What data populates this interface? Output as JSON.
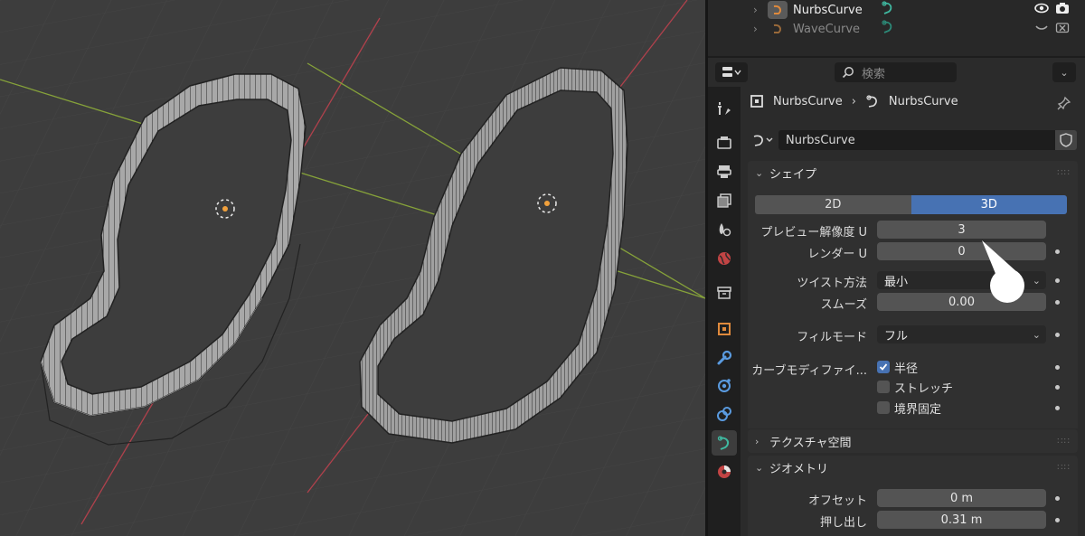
{
  "outliner": {
    "rows": [
      {
        "name": "NurbsCurve",
        "selected": true
      },
      {
        "name": "WaveCurve",
        "selected": false
      }
    ]
  },
  "header": {
    "search_placeholder": "検索"
  },
  "breadcrumb": {
    "object": "NurbsCurve",
    "data": "NurbsCurve"
  },
  "datablock": {
    "name": "NurbsCurve"
  },
  "shape_panel": {
    "title": "シェイプ",
    "dim_2d": "2D",
    "dim_3d": "3D",
    "preview_u_label": "プレビュー解像度 U",
    "preview_u_value": "3",
    "render_u_label": "レンダー U",
    "render_u_value": "0",
    "twist_label": "ツイスト方法",
    "twist_value": "最小",
    "smooth_label": "スムーズ",
    "smooth_value": "0.00",
    "fill_label": "フィルモード",
    "fill_value": "フル",
    "modifier_label": "カーブモディファイ...",
    "radius_label": "半径",
    "stretch_label": "ストレッチ",
    "bounds_label": "境界固定"
  },
  "texture_panel": {
    "title": "テクスチャ空間"
  },
  "geometry_panel": {
    "title": "ジオメトリ",
    "offset_label": "オフセット",
    "offset_value": "0 m",
    "extrude_label": "押し出し",
    "extrude_value": "0.31 m"
  },
  "colors": {
    "accent": "#4772b3",
    "curve_icon": "#3fb8a0",
    "object_icon": "#e08a3c"
  }
}
